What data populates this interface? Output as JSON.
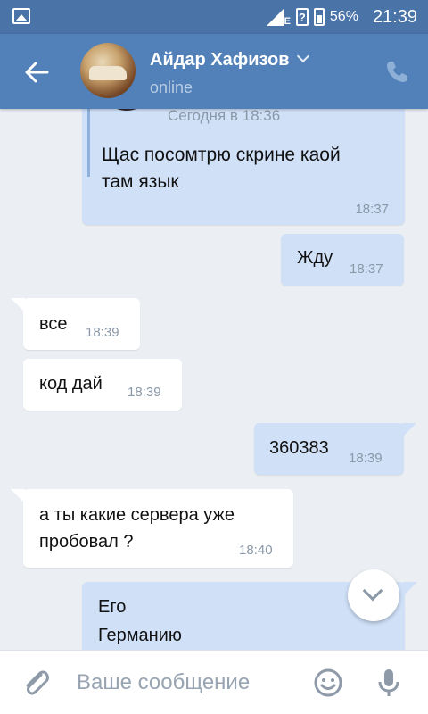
{
  "status_bar": {
    "network": "E",
    "battery_percent": "56%",
    "time": "21:39"
  },
  "header": {
    "contact_name": "Айдар Хафизов",
    "status": "online",
    "icons": [
      "back-arrow-icon",
      "chevron-down-icon",
      "phone-icon"
    ]
  },
  "forwarded": {
    "date": "Сегодня в 18:36",
    "text_line1": "Щас посомтрю скрине каой",
    "text_line2": "там язык",
    "time": "18:37"
  },
  "messages": [
    {
      "direction": "out",
      "text": "Жду",
      "time": "18:37"
    },
    {
      "direction": "in",
      "text": "все",
      "time": "18:39"
    },
    {
      "direction": "in",
      "text": "код дай",
      "time": "18:39"
    },
    {
      "direction": "out",
      "text": "360383",
      "time": "18:39"
    },
    {
      "direction": "in",
      "text_line1": "а ты какие сервера уже",
      "text_line2": "пробовал ?",
      "time": "18:40"
    },
    {
      "direction": "out",
      "text_line1": "Его",
      "text_line2": "Германию"
    }
  ],
  "composer": {
    "placeholder": "Ваше сообщение",
    "icons": [
      "attach-icon",
      "emoji-icon",
      "microphone-icon"
    ]
  },
  "colors": {
    "header": "#5181b8",
    "status_bar": "#4a73a8",
    "outgoing_bubble": "#cfe0f7",
    "incoming_bubble": "#ffffff",
    "chat_background": "#ebeef2"
  }
}
